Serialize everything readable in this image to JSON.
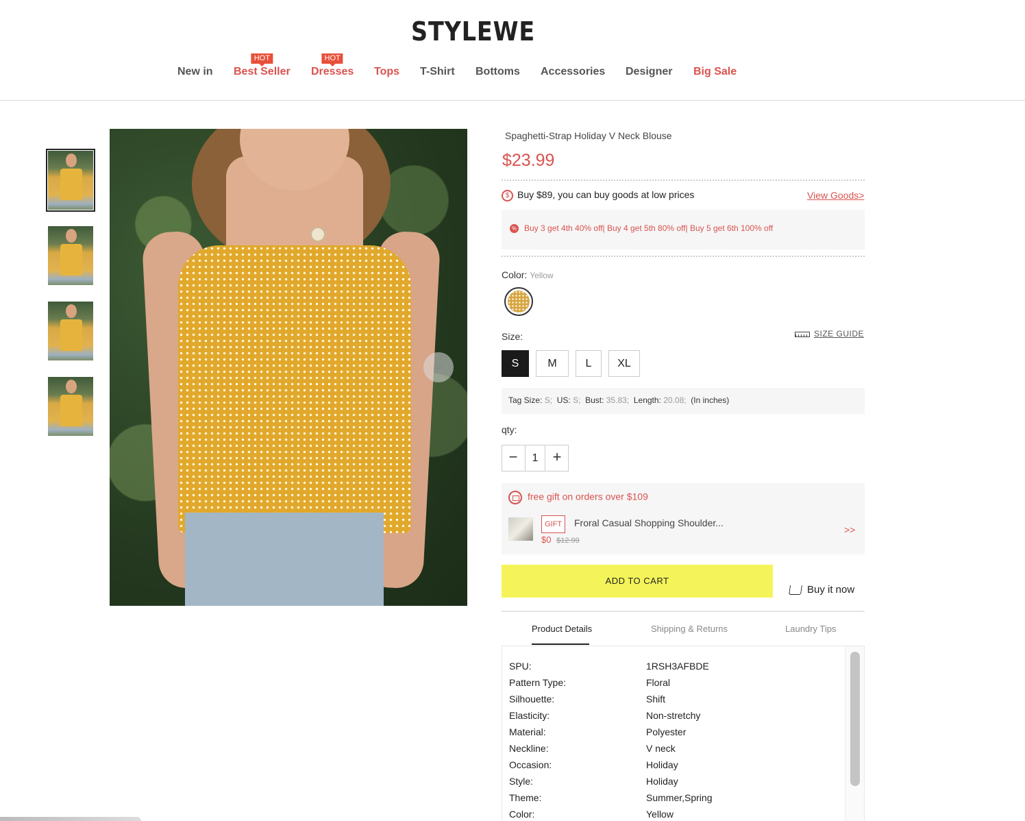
{
  "brand": {
    "logo": "STYLEWE"
  },
  "nav": {
    "items": [
      {
        "label": "New in",
        "hot": false,
        "highlight": false
      },
      {
        "label": "Best Seller",
        "hot": true,
        "highlight": true
      },
      {
        "label": "Dresses",
        "hot": true,
        "highlight": true
      },
      {
        "label": "Tops",
        "hot": false,
        "highlight": true
      },
      {
        "label": "T-Shirt",
        "hot": false,
        "highlight": false
      },
      {
        "label": "Bottoms",
        "hot": false,
        "highlight": false
      },
      {
        "label": "Accessories",
        "hot": false,
        "highlight": false
      },
      {
        "label": "Designer",
        "hot": false,
        "highlight": false
      },
      {
        "label": "Big Sale",
        "hot": false,
        "highlight": true
      }
    ],
    "hot_badge": "HOT"
  },
  "gallery": {
    "thumbnail_count": 4,
    "selected_index": 0,
    "next_arrow": ">"
  },
  "product": {
    "title": "Spaghetti-Strap Holiday V Neck Blouse",
    "price": "$23.99",
    "promo_line": "Buy $89, you can buy goods at low prices",
    "view_goods": "View Goods>",
    "discount_text": "Buy 3 get 4th 40% off| Buy 4 get 5th 80% off| Buy 5 get 6th 100% off",
    "color_label": "Color:",
    "color_value": "Yellow",
    "size_label": "Size:",
    "size_guide": "SIZE GUIDE",
    "sizes": [
      "S",
      "M",
      "L",
      "XL"
    ],
    "selected_size": "S",
    "size_info": {
      "tag_label": "Tag Size:",
      "tag_value": "S;",
      "us_label": "US:",
      "us_value": "S;",
      "bust_label": "Bust:",
      "bust_value": "35.83;",
      "length_label": "Length:",
      "length_value": "20.08;",
      "unit": "(In inches)"
    },
    "qty_label": "qty:",
    "qty_value": "1",
    "qty_minus": "−",
    "qty_plus": "+"
  },
  "gift": {
    "headline": "free gift on orders over $109",
    "tag": "GIFT",
    "name": "Froral Casual Shopping Shoulder...",
    "price": "$0",
    "original_price": "$12.99",
    "more": ">>"
  },
  "actions": {
    "add_to_cart": "ADD TO CART",
    "buy_now": "Buy it now"
  },
  "tabs": [
    "Product Details",
    "Shipping & Returns",
    "Laundry Tips"
  ],
  "details": [
    {
      "k": "SPU:",
      "v": "1RSH3AFBDE"
    },
    {
      "k": "Pattern Type:",
      "v": "Floral"
    },
    {
      "k": "Silhouette:",
      "v": "Shift"
    },
    {
      "k": "Elasticity:",
      "v": "Non-stretchy"
    },
    {
      "k": "Material:",
      "v": "Polyester"
    },
    {
      "k": "Neckline:",
      "v": "V neck"
    },
    {
      "k": "Occasion:",
      "v": "Holiday"
    },
    {
      "k": "Style:",
      "v": "Holiday"
    },
    {
      "k": "Theme:",
      "v": "Summer,Spring"
    },
    {
      "k": "Color:",
      "v": "Yellow"
    }
  ],
  "colors": {
    "accent": "#d9534f",
    "cart_button": "#f4f45a",
    "hot_badge": "#e8503a"
  }
}
